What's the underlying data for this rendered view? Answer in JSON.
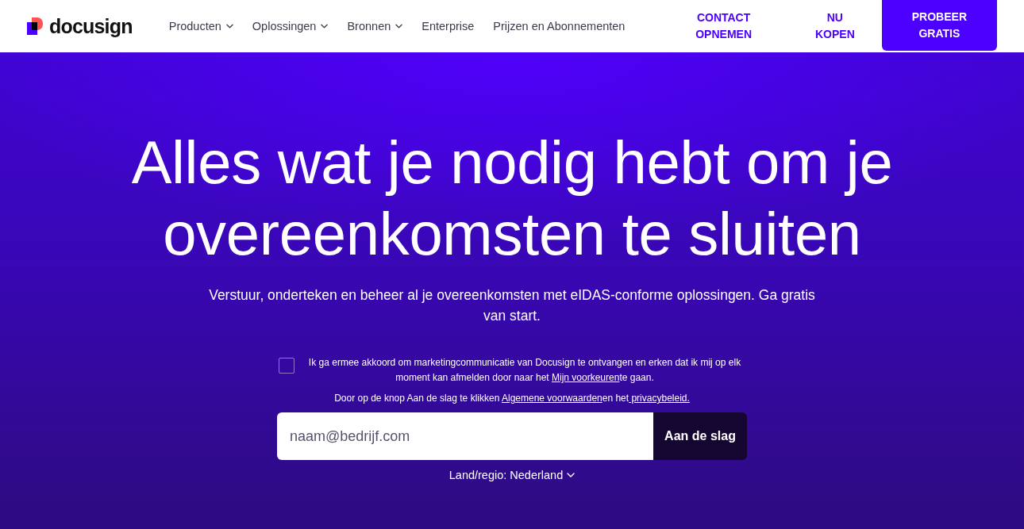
{
  "header": {
    "logo": "docusign",
    "nav": [
      {
        "label": "Producten",
        "kind": "dropdown"
      },
      {
        "label": "Oplossingen",
        "kind": "dropdown"
      },
      {
        "label": "Bronnen",
        "kind": "dropdown"
      },
      {
        "label": "Enterprise",
        "kind": "link"
      },
      {
        "label": "Prijzen en Abonnementen",
        "kind": "link"
      }
    ],
    "actions": [
      {
        "label": "CONTACT OPNEMEN",
        "kind": "text"
      },
      {
        "label": "NU KOPEN",
        "kind": "text"
      },
      {
        "label": "PROBEER GRATIS",
        "kind": "primary"
      }
    ]
  },
  "hero": {
    "title": "Alles wat je nodig hebt om je overeenkomsten te sluiten",
    "subtitle": "Verstuur, onderteken en beheer al je overeenkomsten met eIDAS-conforme oplossingen. Ga gratis van start.",
    "consent": {
      "checked": false,
      "parts": [
        {
          "kind": "text",
          "text": "Ik ga ermee akkoord om marketingcommunicatie van Docusign te ontvangen en erken dat ik mij op elk moment kan afmelden door naar het "
        },
        {
          "kind": "link",
          "text": "Mijn voorkeuren"
        },
        {
          "kind": "text",
          "text": "te gaan."
        }
      ]
    },
    "terms": {
      "parts": [
        {
          "kind": "text",
          "text": "Door op de knop Aan de slag te klikken "
        },
        {
          "kind": "link",
          "text": "Algemene voorwaarden"
        },
        {
          "kind": "text",
          "text": "en het"
        },
        {
          "kind": "link",
          "text": " privacybeleid."
        }
      ]
    },
    "email": {
      "placeholder": "naam@bedrijf.com"
    },
    "submit": "Aan de slag",
    "region": {
      "label": "Land/regio: Nederland",
      "kind": "dropdown"
    }
  }
}
